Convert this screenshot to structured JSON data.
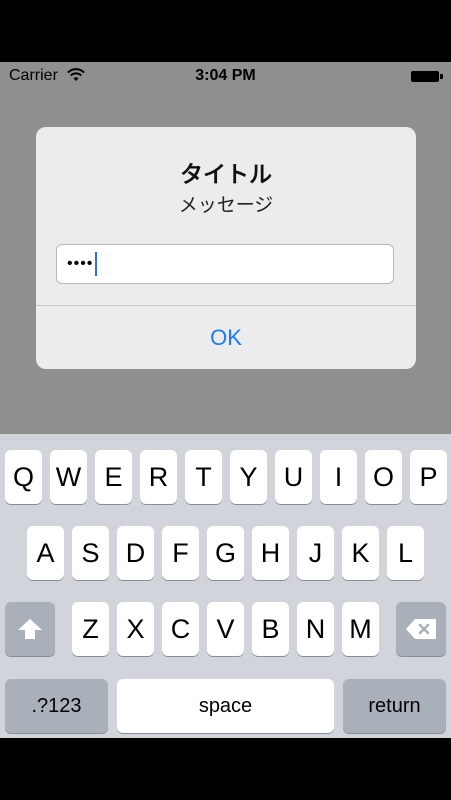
{
  "status_bar": {
    "carrier": "Carrier",
    "time": "3:04 PM"
  },
  "alert": {
    "title": "タイトル",
    "message": "メッセージ",
    "input_value": "••••",
    "button_label": "OK",
    "button_color": "#1a7cf5"
  },
  "keyboard": {
    "row1": [
      "Q",
      "W",
      "E",
      "R",
      "T",
      "Y",
      "U",
      "I",
      "O",
      "P"
    ],
    "row2": [
      "A",
      "S",
      "D",
      "F",
      "G",
      "H",
      "J",
      "K",
      "L"
    ],
    "row3": [
      "Z",
      "X",
      "C",
      "V",
      "B",
      "N",
      "M"
    ],
    "shift_icon": "shift-arrow-icon",
    "delete_icon": "delete-backspace-icon",
    "numbers_label": ".?123",
    "space_label": "space",
    "return_label": "return"
  }
}
